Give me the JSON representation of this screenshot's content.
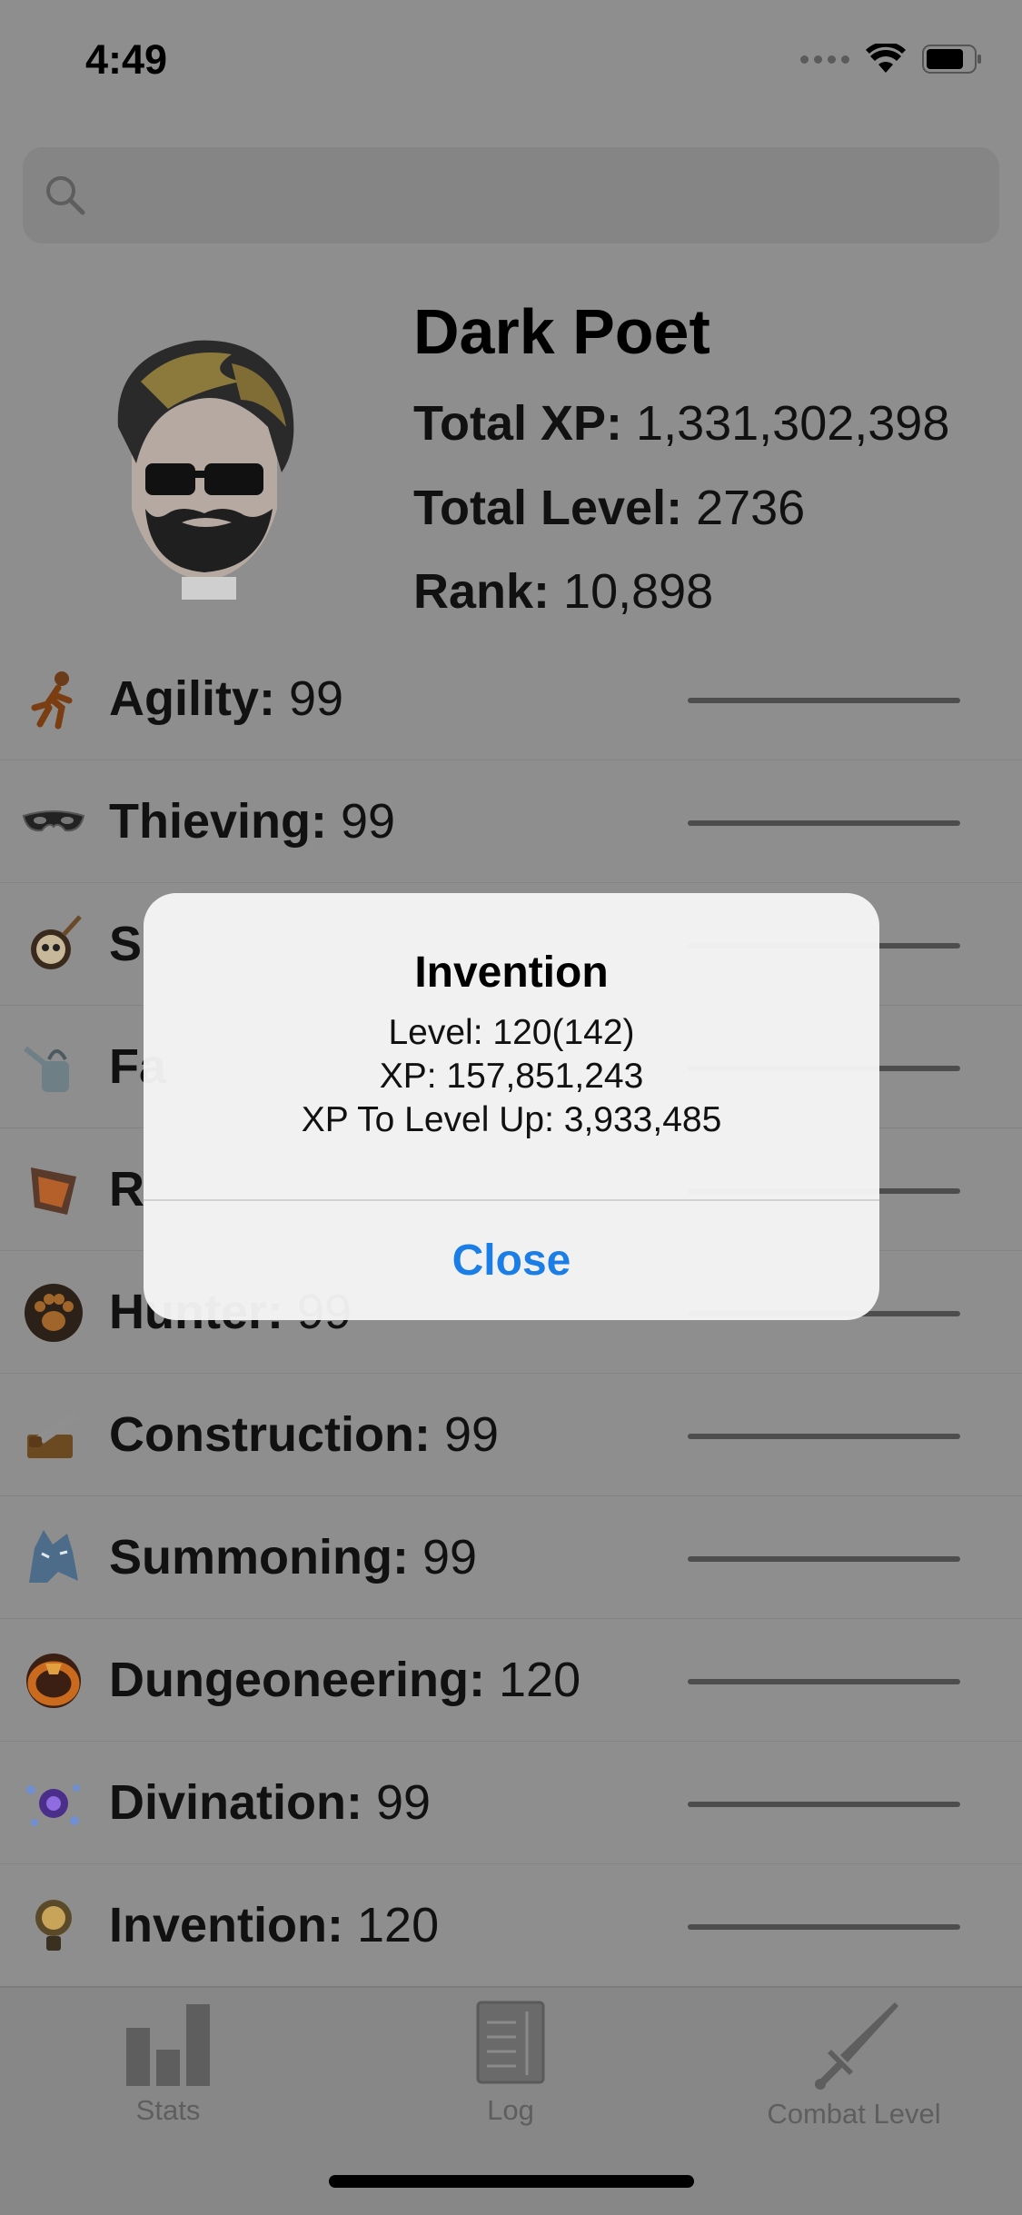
{
  "status_bar": {
    "time": "4:49"
  },
  "profile": {
    "name": "Dark Poet",
    "total_xp_label": "Total XP:",
    "total_xp": "1,331,302,398",
    "total_level_label": "Total Level:",
    "total_level": "2736",
    "rank_label": "Rank:",
    "rank": "10,898"
  },
  "skills": [
    {
      "name": "Agility:",
      "level": "99",
      "icon": "running-figure-icon"
    },
    {
      "name": "Thieving:",
      "level": "99",
      "icon": "mask-icon"
    },
    {
      "name": "S",
      "level": "",
      "icon": "skull-staff-icon"
    },
    {
      "name": "Fa",
      "level": "",
      "icon": "watering-can-icon"
    },
    {
      "name": "R",
      "level": "",
      "icon": "runecrafting-icon"
    },
    {
      "name": "Hunter:",
      "level": "99",
      "icon": "paw-print-icon"
    },
    {
      "name": "Construction:",
      "level": "99",
      "icon": "saw-icon"
    },
    {
      "name": "Summoning:",
      "level": "99",
      "icon": "wolf-icon"
    },
    {
      "name": "Dungeoneering:",
      "level": "120",
      "icon": "ring-icon"
    },
    {
      "name": "Divination:",
      "level": "99",
      "icon": "wisp-icon"
    },
    {
      "name": "Invention:",
      "level": "120",
      "icon": "lightbulb-icon"
    }
  ],
  "tab_bar": {
    "stats_label": "Stats",
    "log_label": "Log",
    "combat_label": "Combat Level"
  },
  "alert": {
    "title": "Invention",
    "line1": "Level: 120(142)",
    "line2": "XP: 157,851,243",
    "line3": "XP To Level Up: 3,933,485",
    "button": "Close"
  },
  "colors": {
    "accent": "#1a7ee6",
    "dim_background": "#8e8e8e"
  }
}
